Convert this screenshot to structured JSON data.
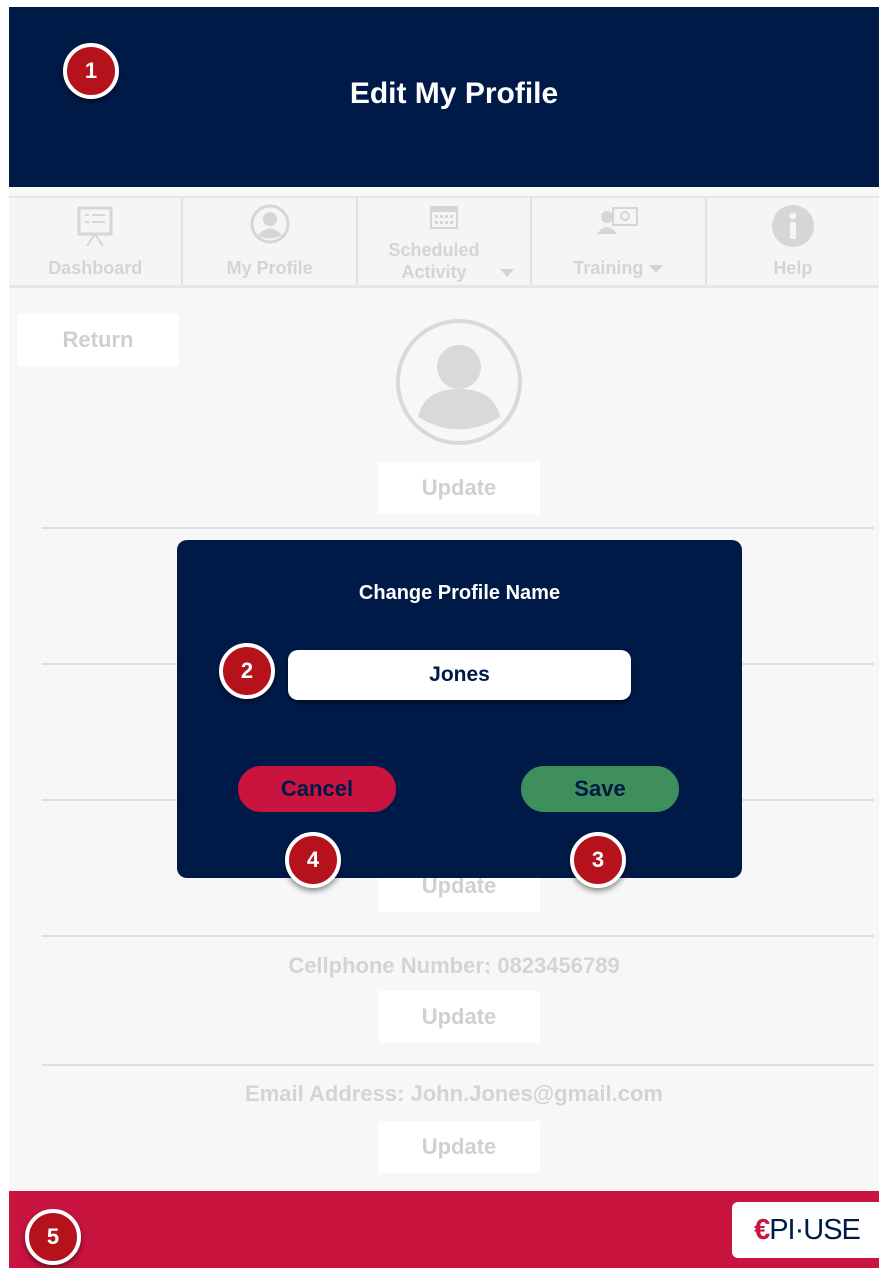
{
  "header": {
    "title": "Edit My Profile"
  },
  "nav": {
    "items": [
      {
        "label": "Dashboard",
        "icon": "presentation-board-icon"
      },
      {
        "label": "My Profile",
        "icon": "user-circle-icon"
      },
      {
        "label": "Scheduled Activity",
        "icon": "calendar-icon",
        "has_dropdown": true
      },
      {
        "label": "Training",
        "icon": "training-icon",
        "has_dropdown": true
      },
      {
        "label": "Help",
        "icon": "info-icon"
      }
    ]
  },
  "content": {
    "return_label": "Return",
    "update_label": "Update",
    "cellphone_label": "Cellphone Number: 0823456789",
    "email_label": "Email Address: John.Jones@gmail.com"
  },
  "modal": {
    "title": "Change Profile Name",
    "name_value": "Jones",
    "cancel_label": "Cancel",
    "save_label": "Save"
  },
  "markers": [
    "1",
    "2",
    "3",
    "4",
    "5"
  ],
  "footer": {
    "logo_text": "EPI·USE"
  },
  "colors": {
    "navy": "#001a48",
    "crimson": "#c8143f",
    "green": "#3f8f5c",
    "marker_red": "#b5121b"
  }
}
